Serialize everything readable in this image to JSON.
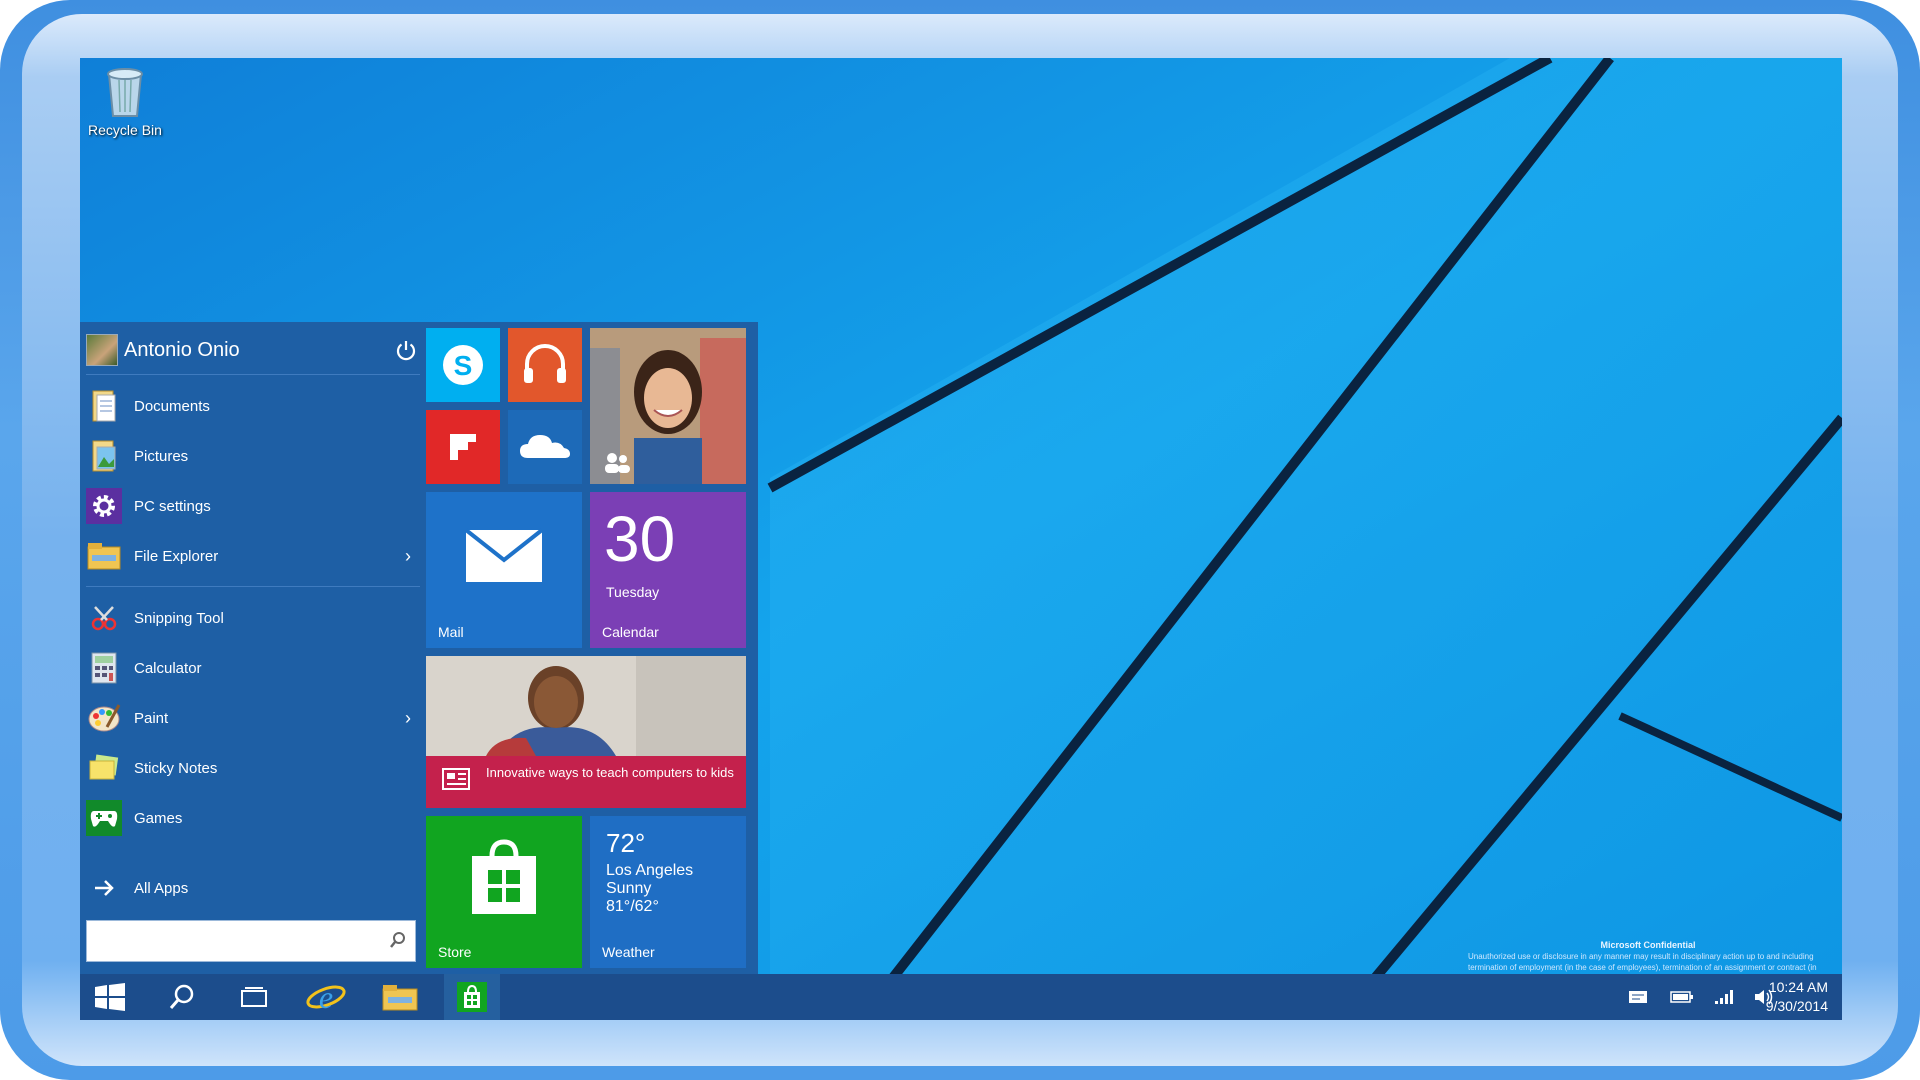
{
  "desktop": {
    "recycle_bin_label": "Recycle Bin",
    "confidential_title": "Microsoft Confidential",
    "confidential_text": "Unauthorized use or disclosure in any manner may result in disciplinary action up to and including termination of employment (in the case of employees), termination of an assignment or contract (in the case of contingent staff), and potential civil and criminal liability."
  },
  "start_menu": {
    "user_name": "Antonio Onio",
    "items": [
      {
        "label": "Documents",
        "icon": "documents-icon"
      },
      {
        "label": "Pictures",
        "icon": "pictures-icon"
      },
      {
        "label": "PC settings",
        "icon": "gear-icon"
      },
      {
        "label": "File Explorer",
        "icon": "folder-icon"
      },
      {
        "label": "Snipping Tool",
        "icon": "scissors-icon"
      },
      {
        "label": "Calculator",
        "icon": "calculator-icon"
      },
      {
        "label": "Paint",
        "icon": "palette-icon"
      },
      {
        "label": "Sticky Notes",
        "icon": "sticky-notes-icon"
      },
      {
        "label": "Games",
        "icon": "gamepad-icon"
      }
    ],
    "all_apps_label": "All Apps",
    "search_placeholder": ""
  },
  "tiles": {
    "mail_label": "Mail",
    "calendar_day_number": "30",
    "calendar_day_name": "Tuesday",
    "calendar_label": "Calendar",
    "news_headline": "Innovative ways to teach computers to kids",
    "store_label": "Store",
    "weather_temp": "72°",
    "weather_city": "Los Angeles",
    "weather_condition": "Sunny",
    "weather_range": "81°/62°",
    "weather_label": "Weather"
  },
  "taskbar": {
    "time": "10:24 AM",
    "date": "9/30/2014"
  },
  "colors": {
    "start_bg": "#1e5fa5",
    "skype": "#00aff0",
    "music": "#e2572c",
    "flipboard": "#e12828",
    "onedrive": "#1d6ab8",
    "mail": "#1e72c9",
    "calendar": "#7b3fb5",
    "news_strip": "#c4214c",
    "store": "#11a520",
    "weather": "#1f6ec4"
  }
}
